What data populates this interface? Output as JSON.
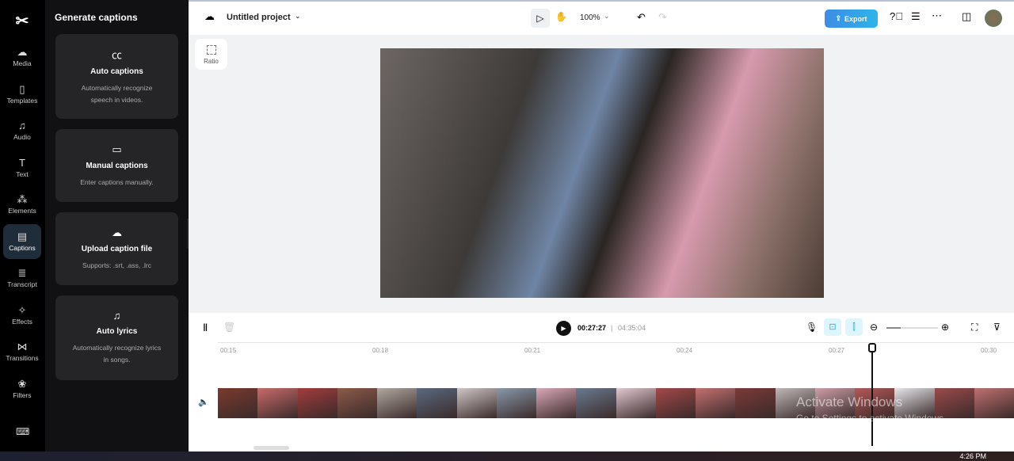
{
  "rail": {
    "items": [
      {
        "label": "Media",
        "icon": "cloud-upload-icon"
      },
      {
        "label": "Templates",
        "icon": "templates-icon"
      },
      {
        "label": "Audio",
        "icon": "music-icon"
      },
      {
        "label": "Text",
        "icon": "text-icon"
      },
      {
        "label": "Elements",
        "icon": "elements-icon"
      },
      {
        "label": "Captions",
        "icon": "captions-icon",
        "active": true
      },
      {
        "label": "Transcript",
        "icon": "transcript-icon"
      },
      {
        "label": "Effects",
        "icon": "effects-icon"
      },
      {
        "label": "Transitions",
        "icon": "transitions-icon"
      },
      {
        "label": "Filters",
        "icon": "filters-icon"
      }
    ]
  },
  "panel": {
    "title": "Generate captions",
    "cards": [
      {
        "title": "Auto captions",
        "desc": "Automatically recognize speech in videos."
      },
      {
        "title": "Manual captions",
        "desc": "Enter captions manually."
      },
      {
        "title": "Upload caption file",
        "desc": "Supports: .srt, .ass, .lrc"
      },
      {
        "title": "Auto lyrics",
        "desc": "Automatically recognize lyrics in songs."
      }
    ]
  },
  "topbar": {
    "project": "Untitled project",
    "zoom": "100%",
    "export": "Export"
  },
  "canvas": {
    "ratio": "Ratio"
  },
  "timeline": {
    "current": "00:27:27",
    "total": "04:35:04",
    "ticks": [
      "00:15",
      "00:18",
      "00:21",
      "00:24",
      "00:27",
      "00:30"
    ]
  },
  "watermark": {
    "line1": "Activate Windows",
    "line2": "Go to Settings to activate Windows."
  },
  "taskbar": {
    "time": "4:26 PM"
  },
  "colors": {
    "accent": "#3e8be6"
  }
}
